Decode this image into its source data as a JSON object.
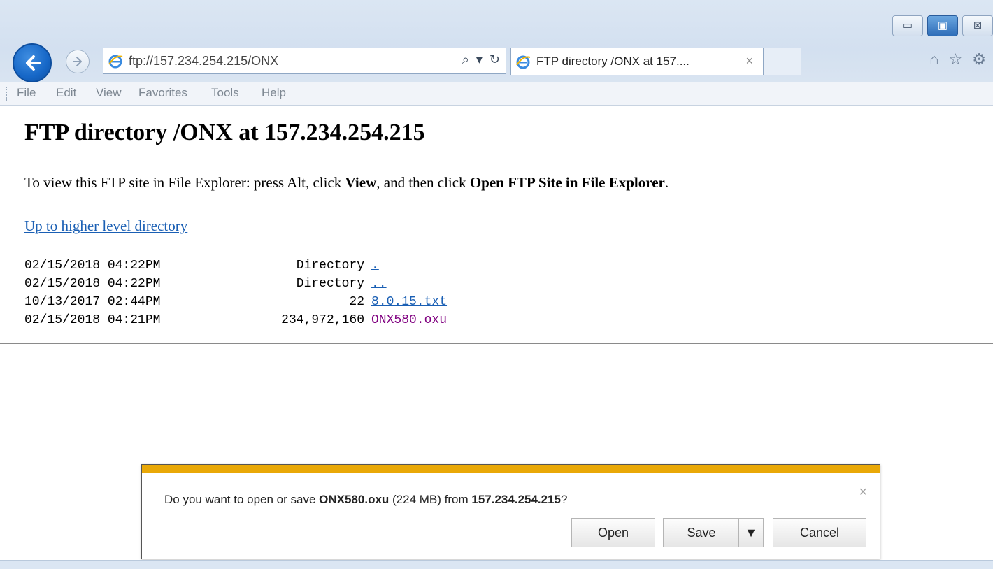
{
  "window": {
    "minimize_glyph": "▭",
    "maximize_glyph": "▣",
    "close_glyph": "⊠"
  },
  "nav": {
    "address": "ftp://157.234.254.215/ONX",
    "search_glyph": "⌕",
    "dropdown_glyph": "▾",
    "refresh_glyph": "↻"
  },
  "tab": {
    "title": "FTP directory /ONX at 157....",
    "close_glyph": "×"
  },
  "toolbar_icons": {
    "home": "⌂",
    "favorites": "☆",
    "settings": "⚙"
  },
  "menu": {
    "items": [
      "File",
      "Edit",
      "View",
      "Favorites",
      "Tools",
      "Help"
    ]
  },
  "page": {
    "heading": "FTP directory /ONX at 157.234.254.215",
    "instr_prefix": "To view this FTP site in File Explorer: press Alt, click ",
    "instr_view": "View",
    "instr_mid": ", and then click ",
    "instr_open": "Open FTP Site in File Explorer",
    "instr_end": ".",
    "up_link": "Up to higher level directory",
    "listing": [
      {
        "date": "02/15/2018 04:22PM",
        "size": "Directory",
        "name": "."
      },
      {
        "date": "02/15/2018 04:22PM",
        "size": "Directory",
        "name": ".."
      },
      {
        "date": "10/13/2017 02:44PM",
        "size": "22",
        "name": "8.0.15.txt"
      },
      {
        "date": "02/15/2018 04:21PM",
        "size": "234,972,160",
        "name": "ONX580.oxu"
      }
    ]
  },
  "download": {
    "msg_prefix": "Do you want to open or save ",
    "filename": "ONX580.oxu",
    "msg_size": " (224 MB) from ",
    "host": "157.234.254.215",
    "msg_end": "?",
    "close_glyph": "×",
    "open_label": "Open",
    "save_label": "Save",
    "save_arrow": "▼",
    "cancel_label": "Cancel"
  },
  "colors": {
    "accent_bar": "#e9a807",
    "link": "#1a5fb4",
    "visited_link": "#800080"
  }
}
